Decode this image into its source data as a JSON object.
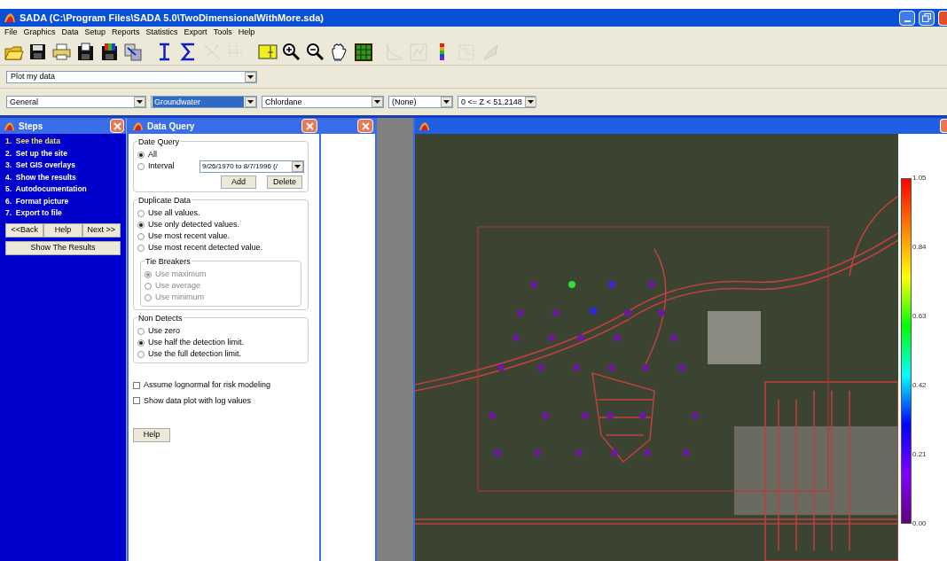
{
  "window": {
    "title": "SADA (C:\\Program Files\\SADA 5.0\\TwoDimensionalWithMore.sda)"
  },
  "menu": [
    "File",
    "Graphics",
    "Data",
    "Setup",
    "Reports",
    "Statistics",
    "Export",
    "Tools",
    "Help"
  ],
  "toolbar": [
    {
      "disabled": false
    },
    {
      "disabled": false
    },
    {
      "disabled": false
    },
    {
      "disabled": false
    },
    {
      "disabled": false
    },
    {
      "disabled": false
    },
    {
      "disabled": false
    },
    {
      "disabled": false
    },
    {
      "disabled": true
    },
    {
      "disabled": true
    },
    {
      "disabled": false
    },
    {
      "disabled": false
    },
    {
      "disabled": false
    },
    {
      "disabled": false
    },
    {
      "disabled": false
    },
    {
      "disabled": true
    },
    {
      "disabled": true
    },
    {
      "disabled": false
    },
    {
      "disabled": true
    },
    {
      "disabled": true
    }
  ],
  "plot_select": {
    "value": "Plot my data"
  },
  "selectors": [
    {
      "value": "General",
      "selected": false
    },
    {
      "value": "Groundwater",
      "selected": true
    },
    {
      "value": "Chlordane",
      "selected": false
    },
    {
      "value": "(None)",
      "selected": false
    },
    {
      "value": "0 <= Z < 51.2148",
      "selected": false
    }
  ],
  "steps_panel": {
    "title": "Steps",
    "items": [
      {
        "label": "1.  See the data",
        "selected": true
      },
      {
        "label": "2.  Set up the site",
        "selected": false
      },
      {
        "label": "3.  Set GIS overlays",
        "selected": false
      },
      {
        "label": "4.  Show the results",
        "selected": false
      },
      {
        "label": "5.  Autodocumentation",
        "selected": false
      },
      {
        "label": "6.  Format picture",
        "selected": false
      },
      {
        "label": "7.  Export to file",
        "selected": false
      }
    ],
    "nav_buttons": [
      "<<Back",
      "Help",
      "Next >>"
    ],
    "results_button": "Show The Results"
  },
  "data_query": {
    "title": "Data Query",
    "date_query": {
      "title": "Date Query",
      "options": [
        {
          "label": "All",
          "selected": true
        },
        {
          "label": "Interval",
          "selected": false
        }
      ],
      "interval_select": "9/26/1970 to 8/7/1996 (/",
      "buttons": [
        "Add",
        "Delete"
      ]
    },
    "duplicate_data": {
      "title": "Duplicate Data",
      "options": [
        {
          "label": "Use all values.",
          "selected": false
        },
        {
          "label": "Use only detected values.",
          "selected": true
        },
        {
          "label": "Use most recent value.",
          "selected": false
        },
        {
          "label": "Use most recent detected value.",
          "selected": false
        }
      ],
      "tie_breakers": {
        "title": "Tie Breakers",
        "disabled": true,
        "options": [
          {
            "label": "Use maximum",
            "selected": true
          },
          {
            "label": "Use average",
            "selected": false
          },
          {
            "label": "Use minimum",
            "selected": false
          }
        ]
      }
    },
    "non_detects": {
      "title": "Non Detects",
      "options": [
        {
          "label": "Use zero",
          "selected": false
        },
        {
          "label": "Use half the detection limit.",
          "selected": true
        },
        {
          "label": "Use the full detection limit.",
          "selected": false
        }
      ]
    },
    "checkboxes": [
      {
        "label": "Assume lognormal for risk modeling",
        "checked": false
      },
      {
        "label": "Show data plot with log values",
        "checked": false
      }
    ],
    "help_button": "Help"
  },
  "map_window": {
    "legend": {
      "ticks": [
        "1.05",
        "0.84",
        "0.63",
        "0.42",
        "0.21",
        "0.00"
      ]
    },
    "points": [
      {
        "color": "#6a1b9a"
      },
      {
        "color": "#33dd33"
      },
      {
        "color": "#4a22d0"
      },
      {
        "color": "#6a1b9a"
      },
      {
        "color": "#6a1b9a"
      },
      {
        "color": "#6a1b9a"
      },
      {
        "color": "#2a2ae0"
      },
      {
        "color": "#6a1b9a"
      },
      {
        "color": "#6a1b9a"
      },
      {
        "color": "#6a1b9a"
      },
      {
        "color": "#6a1b9a"
      },
      {
        "color": "#6a1b9a"
      },
      {
        "color": "#6a1b9a"
      },
      {
        "color": "#6a1b9a"
      },
      {
        "color": "#6a1b9a"
      },
      {
        "color": "#6a1b9a"
      },
      {
        "color": "#6a1b9a"
      },
      {
        "color": "#6a1b9a"
      },
      {
        "color": "#6a1b9a"
      },
      {
        "color": "#6a1b9a"
      },
      {
        "color": "#6a1b9a"
      },
      {
        "color": "#6a1b9a"
      },
      {
        "color": "#6a1b9a"
      },
      {
        "color": "#6a1b9a"
      },
      {
        "color": "#6a1b9a"
      },
      {
        "color": "#6a1b9a"
      },
      {
        "color": "#6a1b9a"
      },
      {
        "color": "#6a1b9a"
      },
      {
        "color": "#6a1b9a"
      },
      {
        "color": "#6a1b9a"
      },
      {
        "color": "#6a1b9a"
      },
      {
        "color": "#6a1b9a"
      }
    ]
  }
}
